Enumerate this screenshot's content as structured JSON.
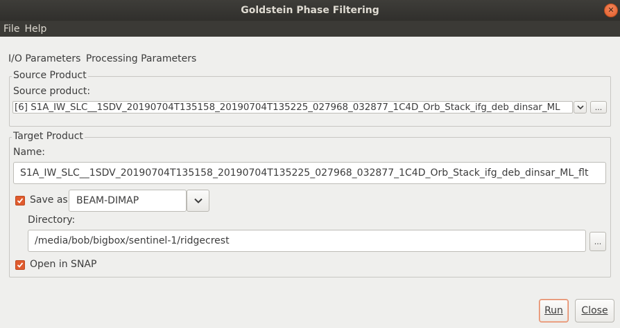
{
  "window": {
    "title": "Goldstein Phase Filtering"
  },
  "menu": {
    "items": [
      "File",
      "Help"
    ]
  },
  "tabs": [
    "I/O Parameters",
    "Processing Parameters"
  ],
  "source": {
    "group_title": "Source Product",
    "label": "Source product:",
    "value": "[6] S1A_IW_SLC__1SDV_20190704T135158_20190704T135225_027968_032877_1C4D_Orb_Stack_ifg_deb_dinsar_ML",
    "browse_label": "..."
  },
  "target": {
    "group_title": "Target Product",
    "name_label": "Name:",
    "name_value": "S1A_IW_SLC__1SDV_20190704T135158_20190704T135225_027968_032877_1C4D_Orb_Stack_ifg_deb_dinsar_ML_flt",
    "save_as_label": "Save as:",
    "save_as_checked": true,
    "format_value": "BEAM-DIMAP",
    "directory_label": "Directory:",
    "directory_value": "/media/bob/bigbox/sentinel-1/ridgecrest",
    "browse_label": "...",
    "open_in_snap_label": "Open in SNAP",
    "open_in_snap_checked": true
  },
  "actions": {
    "run_label": "Run",
    "close_label": "Close"
  }
}
